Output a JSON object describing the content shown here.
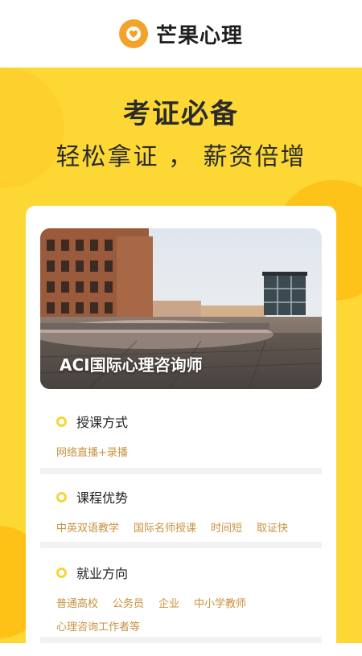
{
  "app": {
    "title": "芒果心理",
    "brand_color": "#f4a32a",
    "logo_icon": "mango-heart-icon"
  },
  "hero": {
    "title": "考证必备",
    "subtitle": "轻松拿证 ， 薪资倍增",
    "bg_color": "#fdd835"
  },
  "course": {
    "image_caption": "ACI国际心理咨询师",
    "sections": [
      {
        "title": "授课方式",
        "tags": [
          "网络直播+录播"
        ]
      },
      {
        "title": "课程优势",
        "tags": [
          "中英双语教学",
          "国际名师授课",
          "时间短",
          "取证快"
        ]
      },
      {
        "title": "就业方向",
        "tags": [
          "普通高校",
          "公务员",
          "企业",
          "中小学教师",
          "心理咨询工作者等"
        ]
      }
    ],
    "tag_color": "#c9913f"
  }
}
